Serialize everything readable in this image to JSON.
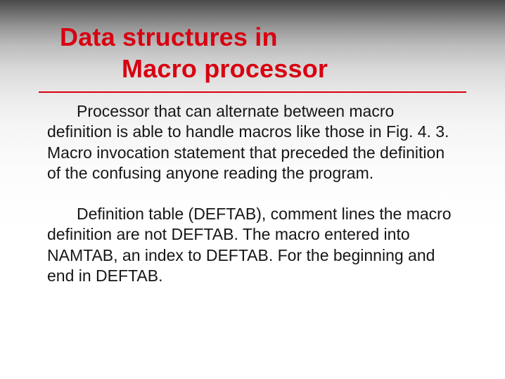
{
  "slide": {
    "title_line1": "Data structures  in",
    "title_line2": "Macro processor",
    "paragraph1": "Processor that can alternate between macro definition is able to handle macros like those in Fig. 4. 3. Macro invocation statement that preceded the definition of the confusing anyone reading the program.",
    "paragraph2": "Definition table (DEFTAB), comment lines the macro definition are not DEFTAB. The macro entered into NAMTAB, an index to DEFTAB. For the beginning and end in DEFTAB."
  }
}
